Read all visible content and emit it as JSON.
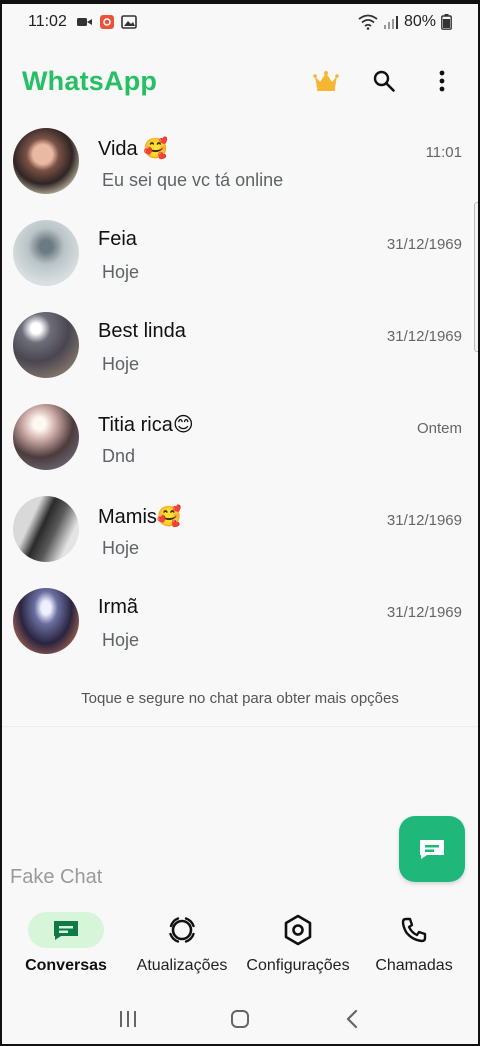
{
  "status_bar": {
    "time": "11:02",
    "battery": "80%"
  },
  "header": {
    "title": "WhatsApp",
    "icons": [
      "crown-icon",
      "search-icon",
      "more-vert-icon"
    ]
  },
  "chats": [
    {
      "name": "Vida 🥰",
      "preview": "Eu sei que vc tá online",
      "time": "11:01"
    },
    {
      "name": "Feia",
      "preview": "Hoje",
      "time": "31/12/1969"
    },
    {
      "name": "Best linda",
      "preview": "Hoje",
      "time": "31/12/1969"
    },
    {
      "name": "Titia rica😊",
      "preview": "Dnd",
      "time": "Ontem"
    },
    {
      "name": "Mamis🥰",
      "preview": "Hoje",
      "time": "31/12/1969"
    },
    {
      "name": "Irmã",
      "preview": "Hoje",
      "time": "31/12/1969"
    }
  ],
  "hint": "Toque e segure no chat para obter mais opções",
  "watermark": "Fake Chat",
  "bottom_nav": [
    {
      "label": "Conversas",
      "icon": "chat-icon",
      "active": true
    },
    {
      "label": "Atualizações",
      "icon": "status-icon",
      "active": false
    },
    {
      "label": "Configurações",
      "icon": "settings-icon",
      "active": false
    },
    {
      "label": "Chamadas",
      "icon": "phone-icon",
      "active": false
    }
  ],
  "colors": {
    "brand": "#25c064",
    "fab": "#1fb87a",
    "active_pill": "#d6f5d9",
    "crown": "#f5b731"
  }
}
